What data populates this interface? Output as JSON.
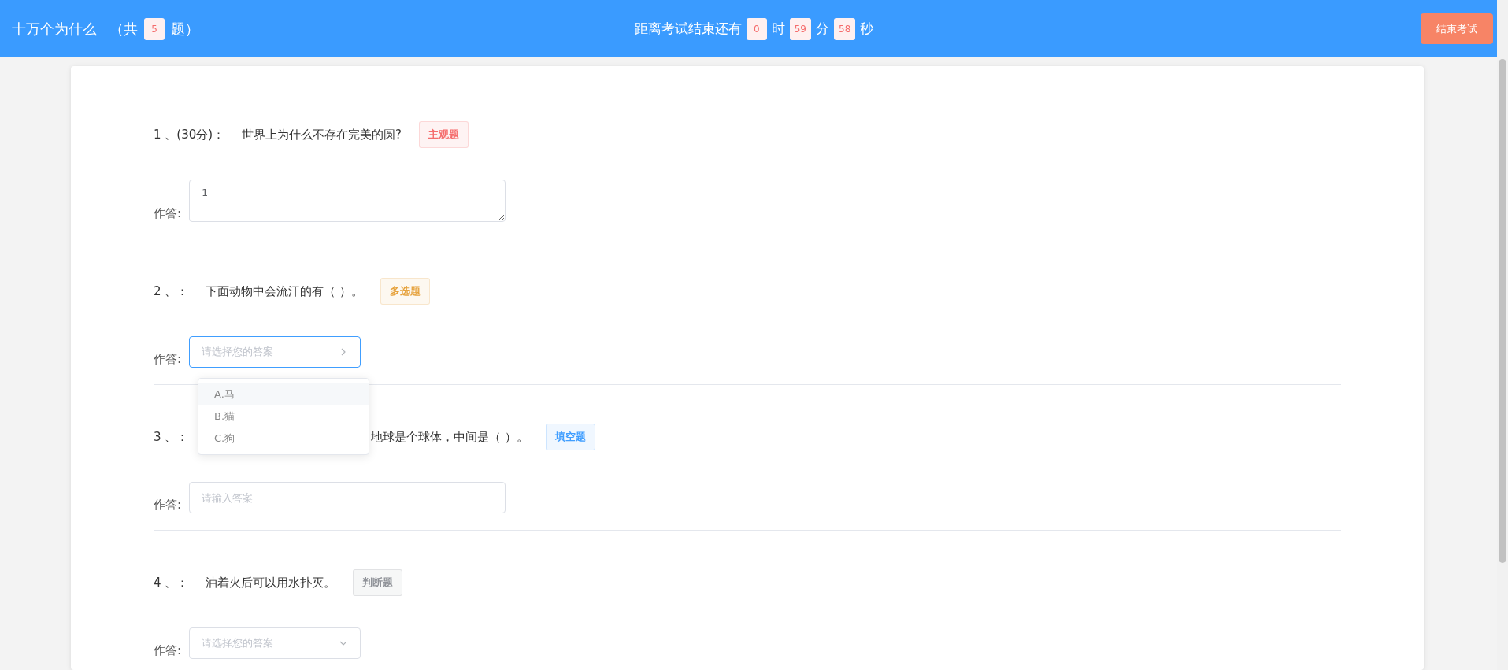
{
  "header": {
    "title": "十万个为什么",
    "count_prefix": "（共",
    "count": "5",
    "count_suffix": "题）",
    "timer_label": "距离考试结束还有",
    "timer": [
      {
        "value": "0",
        "unit": "时"
      },
      {
        "value": "59",
        "unit": "分"
      },
      {
        "value": "58",
        "unit": "秒"
      }
    ],
    "end_button": "结束考试"
  },
  "questions": [
    {
      "number": "1 、(30分)：",
      "text": "世界上为什么不存在完美的圆?",
      "tag": {
        "label": "主观题",
        "color": "#f56c6c"
      },
      "answer_label": "作答:",
      "answer": {
        "kind": "textarea",
        "value": "1"
      }
    },
    {
      "number": "2 、：",
      "text": "下面动物中会流汗的有（ ）。",
      "tag": {
        "label": "多选题",
        "color": "#e6a23c"
      },
      "answer_label": "作答:",
      "answer": {
        "kind": "select",
        "placeholder": "请选择您的答案",
        "open": true,
        "options": [
          {
            "label": "A.马",
            "hovered": true
          },
          {
            "label": "B.猫",
            "hovered": false
          },
          {
            "label": "C.狗",
            "hovered": false
          }
        ]
      }
    },
    {
      "number": "3 、：",
      "text": "地球是个球体，中间是（ ）。",
      "tag": {
        "label": "填空题",
        "color": "#409eff"
      },
      "answer_label": "作答:",
      "answer": {
        "kind": "input",
        "placeholder": "请输入答案"
      }
    },
    {
      "number": "4 、：",
      "text": "油着火后可以用水扑灭。",
      "tag": {
        "label": "判断题",
        "color": "#909399"
      },
      "answer_label": "作答:",
      "answer": {
        "kind": "select",
        "placeholder": "请选择您的答案",
        "open": false
      }
    }
  ]
}
